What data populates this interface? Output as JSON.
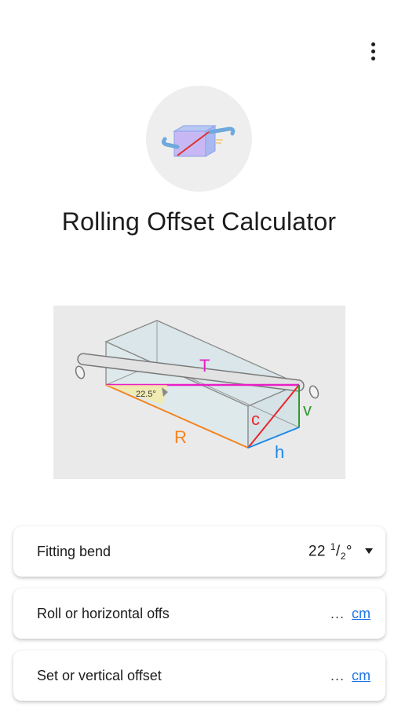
{
  "app": {
    "title": "Rolling Offset Calculator"
  },
  "menu": {
    "icon": "more-vert-icon"
  },
  "diagram": {
    "labels": {
      "t": "T",
      "r": "R",
      "c": "c",
      "v": "v",
      "h": "h",
      "angle": "22.5°"
    },
    "colors": {
      "t": "#e91ec8",
      "r": "#f5841f",
      "c": "#e8262e",
      "v": "#2e9b2e",
      "h": "#1e88e5"
    }
  },
  "fields": {
    "fitting_bend": {
      "label": "Fitting bend",
      "value_whole": "22",
      "value_num": "1",
      "value_den": "2",
      "value_deg": "°"
    },
    "roll": {
      "label": "Roll or horizontal offs",
      "value": "...",
      "unit": "cm"
    },
    "set": {
      "label": "Set or vertical offset",
      "value": "...",
      "unit": "cm"
    }
  },
  "colors": {
    "accent": "#1a73e8",
    "logo_bg": "#eeeeee",
    "diagram_bg": "#eaeaea"
  }
}
